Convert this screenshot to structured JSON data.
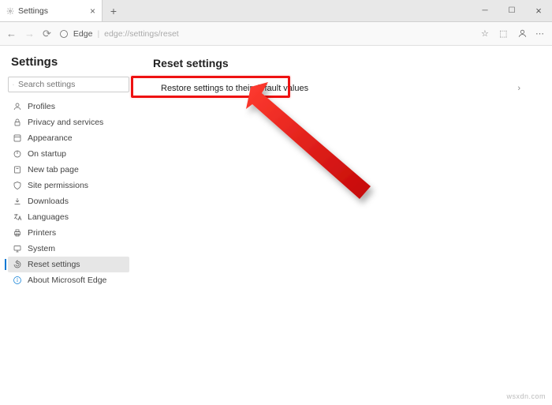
{
  "tab": {
    "title": "Settings"
  },
  "toolbar": {
    "edge_label": "Edge",
    "url": "edge://settings/reset"
  },
  "sidebar": {
    "title": "Settings",
    "search_placeholder": "Search settings",
    "items": [
      {
        "label": "Profiles"
      },
      {
        "label": "Privacy and services"
      },
      {
        "label": "Appearance"
      },
      {
        "label": "On startup"
      },
      {
        "label": "New tab page"
      },
      {
        "label": "Site permissions"
      },
      {
        "label": "Downloads"
      },
      {
        "label": "Languages"
      },
      {
        "label": "Printers"
      },
      {
        "label": "System"
      },
      {
        "label": "Reset settings"
      },
      {
        "label": "About Microsoft Edge"
      }
    ]
  },
  "main": {
    "heading": "Reset settings",
    "restore_label": "Restore settings to their default values"
  },
  "watermark": "wsxdn.com"
}
